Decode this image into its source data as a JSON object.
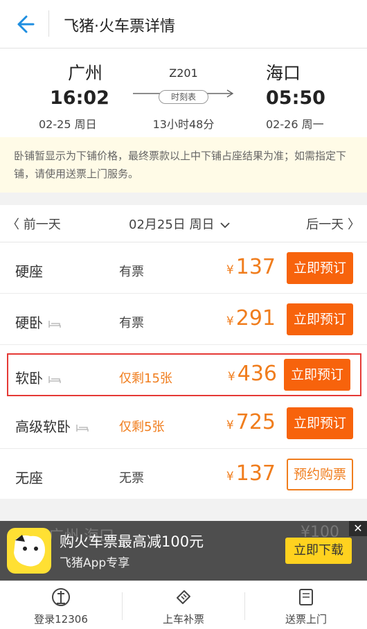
{
  "header": {
    "title": "飞猪·火车票详情"
  },
  "route": {
    "from_city": "广州",
    "to_city": "海口",
    "depart_time": "16:02",
    "arrive_time": "05:50",
    "depart_date": "02-25 周日",
    "arrive_date": "02-26 周一",
    "train_no": "Z201",
    "schedule_label": "时刻表",
    "duration": "13小时48分"
  },
  "notice": "卧铺暂显示为下铺价格，最终票款以上中下铺占座结果为准；如需指定下铺，请使用送票上门服务。",
  "datebar": {
    "prev": "〈 前一天",
    "current": "02月25日 周日",
    "next": "后一天 〉"
  },
  "currency_symbol": "¥",
  "seats": [
    {
      "name": "硬座",
      "availability": "有票",
      "price": "137",
      "button": "立即预订"
    },
    {
      "name": "硬卧",
      "availability": "有票",
      "price": "291",
      "button": "立即预订"
    },
    {
      "name": "软卧",
      "availability": "仅剩15张",
      "price": "436",
      "button": "立即预订"
    },
    {
      "name": "高级软卧",
      "availability": "仅剩5张",
      "price": "725",
      "button": "立即预订"
    },
    {
      "name": "无座",
      "availability": "无票",
      "price": "137",
      "button": "预约购票"
    }
  ],
  "banner": {
    "ghost_left": "广州  海口",
    "ghost_right": "¥100",
    "title": "购火车票最高减100元",
    "subtitle": "飞猪App专享",
    "download": "立即下载",
    "close": "✕"
  },
  "tabs": [
    {
      "label": "登录12306"
    },
    {
      "label": "上车补票"
    },
    {
      "label": "送票上门"
    }
  ],
  "colors": {
    "accent": "#f7630c",
    "price": "#f07d1d",
    "highlight": "#e53935",
    "notice_bg": "#fffbe7"
  }
}
